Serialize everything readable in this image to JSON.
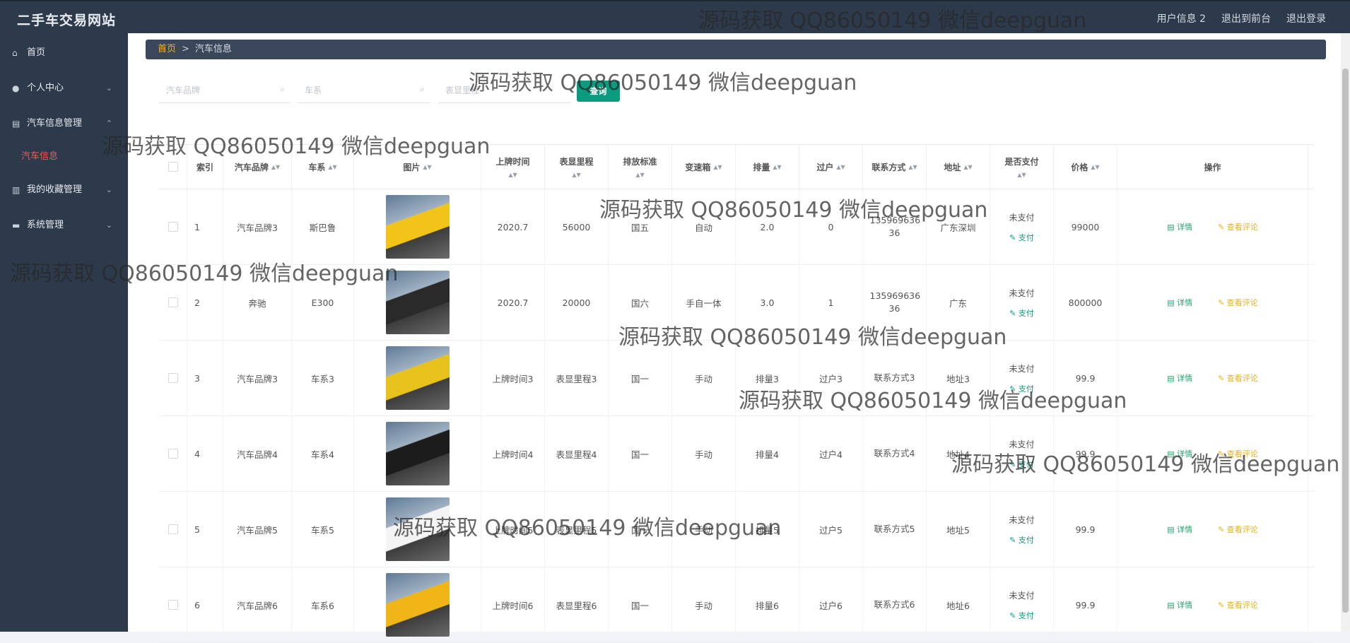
{
  "app": {
    "title": "二手车交易网站"
  },
  "topnav": {
    "user": "用户信息 2",
    "front": "退出到前台",
    "logout": "退出登录"
  },
  "sidebar": {
    "items": [
      {
        "label": "首页",
        "icon": "home-icon"
      },
      {
        "label": "个人中心",
        "icon": "user-icon"
      },
      {
        "label": "汽车信息管理",
        "icon": "car-list-icon"
      },
      {
        "label": "我的收藏管理",
        "icon": "bar-chart-icon"
      },
      {
        "label": "系统管理",
        "icon": "monitor-icon"
      }
    ],
    "sub_active": "汽车信息"
  },
  "breadcrumb": {
    "home": "首页",
    "separator": ">",
    "current": "汽车信息"
  },
  "search": {
    "brand_placeholder": "汽车品牌",
    "series_placeholder": "车系",
    "mileage_placeholder": "表显里程",
    "query_button": "查询"
  },
  "table": {
    "headers": [
      "索引",
      "汽车品牌",
      "车系",
      "图片",
      "上牌时间",
      "表显里程",
      "排放标准",
      "变速箱",
      "排量",
      "过户",
      "联系方式",
      "地址",
      "是否支付",
      "价格",
      "操作"
    ],
    "rows": [
      {
        "index": "1",
        "brand": "汽车品牌3",
        "series": "斯巴鲁",
        "time": "2020.7",
        "mileage": "56000",
        "emission": "国五",
        "gearbox": "自动",
        "displacement": "2.0",
        "transfer": "0",
        "contact": "135969636 36",
        "address": "广东深圳",
        "paid": "未支付",
        "pay": "支付",
        "price": "99000",
        "image_color": "#f2c41a"
      },
      {
        "index": "2",
        "brand": "奔驰",
        "series": "E300",
        "time": "2020.7",
        "mileage": "20000",
        "emission": "国六",
        "gearbox": "手自一体",
        "displacement": "3.0",
        "transfer": "1",
        "contact": "135969636 36",
        "address": "广东",
        "paid": "未支付",
        "pay": "支付",
        "price": "800000",
        "image_color": "#2a2a2a"
      },
      {
        "index": "3",
        "brand": "汽车品牌3",
        "series": "车系3",
        "time": "上牌时间3",
        "mileage": "表显里程3",
        "emission": "国一",
        "gearbox": "手动",
        "displacement": "排量3",
        "transfer": "过户3",
        "contact": "联系方式3",
        "address": "地址3",
        "paid": "未支付",
        "pay": "支付",
        "price": "99.9",
        "image_color": "#e8c21c"
      },
      {
        "index": "4",
        "brand": "汽车品牌4",
        "series": "车系4",
        "time": "上牌时间4",
        "mileage": "表显里程4",
        "emission": "国一",
        "gearbox": "手动",
        "displacement": "排量4",
        "transfer": "过户4",
        "contact": "联系方式4",
        "address": "地址4",
        "paid": "未支付",
        "pay": "支付",
        "price": "99.9",
        "image_color": "#1c1c1c"
      },
      {
        "index": "5",
        "brand": "汽车品牌5",
        "series": "车系5",
        "time": "上牌时间5",
        "mileage": "表显里程5",
        "emission": "国一",
        "gearbox": "手动",
        "displacement": "排量5",
        "transfer": "过户5",
        "contact": "联系方式5",
        "address": "地址5",
        "paid": "未支付",
        "pay": "支付",
        "price": "99.9",
        "image_color": "#f4f4f4"
      },
      {
        "index": "6",
        "brand": "汽车品牌6",
        "series": "车系6",
        "time": "上牌时间6",
        "mileage": "表显里程6",
        "emission": "国一",
        "gearbox": "手动",
        "displacement": "排量6",
        "transfer": "过户6",
        "contact": "联系方式6",
        "address": "地址6",
        "paid": "未支付",
        "pay": "支付",
        "price": "99.9",
        "image_color": "#f0b618"
      }
    ],
    "detail_label": "详情",
    "review_label": "查看评论"
  },
  "watermark": "源码获取 QQ86050149 微信deepguan",
  "colors": {
    "sidebar_bg": "#2d3a4b",
    "accent_green": "#0b9b7e",
    "active_red": "#f05a5a",
    "review_yellow": "#e0b21f",
    "breadcrumb_home": "#f0b429"
  }
}
